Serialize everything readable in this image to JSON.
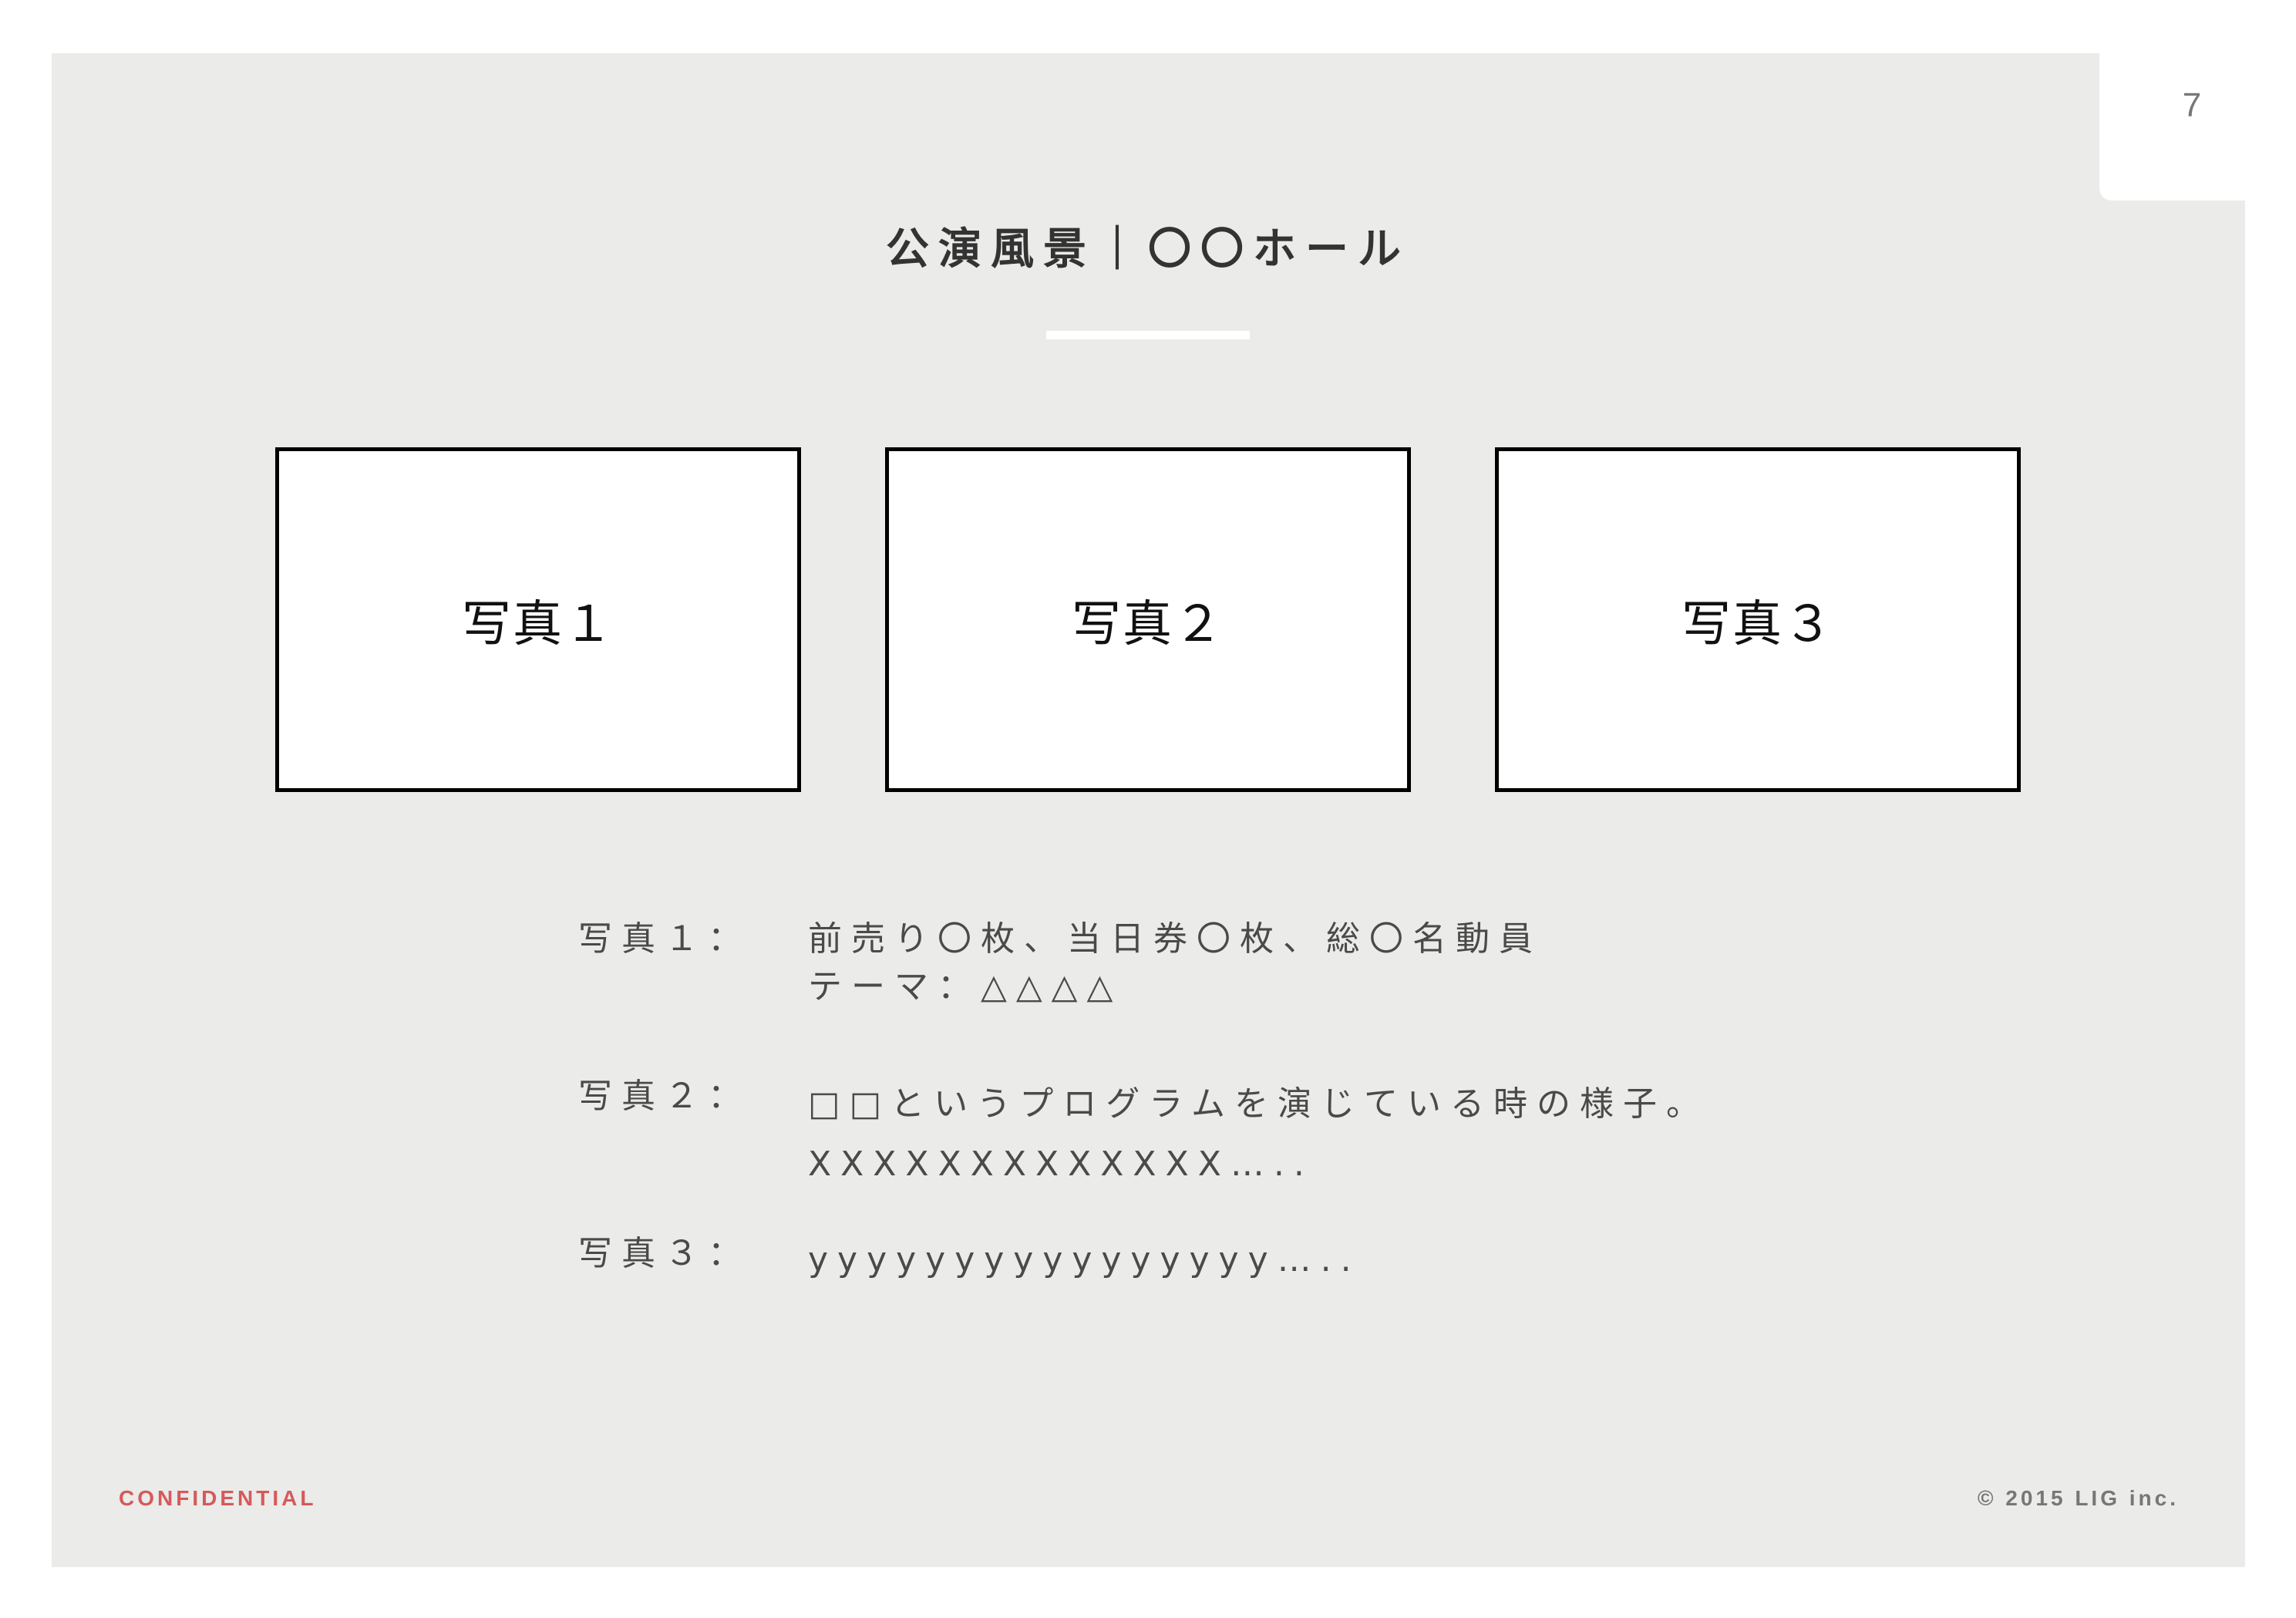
{
  "page": {
    "number": "7",
    "title": "公演風景｜〇〇ホール"
  },
  "photos": [
    {
      "label": "写真１"
    },
    {
      "label": "写真２"
    },
    {
      "label": "写真３"
    }
  ],
  "descriptions": [
    {
      "label": "写真１：",
      "lines": [
        "前売り〇枚、当日券〇枚、総〇名動員",
        "テーマ：△△△△"
      ]
    },
    {
      "label": "写真２：",
      "lines": [
        "□□というプログラムを演じている時の様子。",
        "XXXXXXXXXXXXX….."
      ]
    },
    {
      "label": "写真３：",
      "lines": [
        "yyyyyyyyyyyyyyyy….."
      ]
    }
  ],
  "footer": {
    "confidential": "CONFIDENTIAL",
    "copyright": "© 2015 LIG inc."
  },
  "colors": {
    "panel_background": "#ebebe9",
    "confidential_red": "#d55a5a",
    "body_text": "#4a4a4a",
    "title_text": "#333333"
  }
}
